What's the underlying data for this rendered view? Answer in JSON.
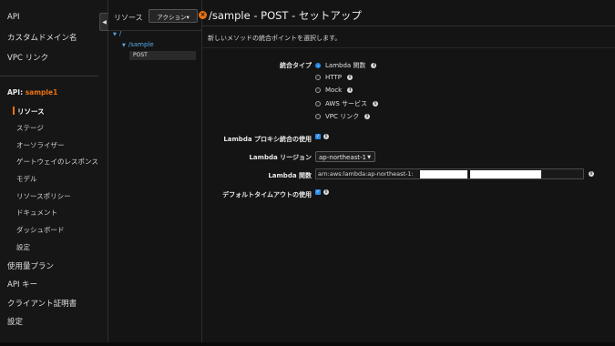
{
  "leftnav": {
    "top_items": [
      "API",
      "カスタムドメイン名",
      "VPC リンク"
    ],
    "api_prefix": "API: ",
    "api_name": "sample1",
    "sub_items": [
      "リソース",
      "ステージ",
      "オーソライザー",
      "ゲートウェイのレスポンス",
      "モデル",
      "リソースポリシー",
      "ドキュメント",
      "ダッシュボード",
      "設定"
    ],
    "bottom_items": [
      "使用量プラン",
      "API キー",
      "クライアント証明書",
      "設定"
    ]
  },
  "tree": {
    "title": "リソース",
    "actions_label": "アクション▾",
    "root": "/",
    "child": "/sample",
    "method": "POST"
  },
  "main": {
    "title": "/sample - POST - セットアップ",
    "subtitle": "新しいメソッドの統合ポイントを選択します。",
    "integration_type_label": "統合タイプ",
    "options": [
      "Lambda 関数",
      "HTTP",
      "Mock",
      "AWS サービス",
      "VPC リンク"
    ],
    "selected_option": "Lambda 関数",
    "proxy_label": "Lambda プロキシ統合の使用",
    "proxy_checked": true,
    "region_label": "Lambda リージョン",
    "region_value": "ap-northeast-1",
    "function_label": "Lambda 関数",
    "function_value": "arn:aws:lambda:ap-northeast-1:",
    "timeout_label": "デフォルトタイムアウトの使用",
    "timeout_checked": true
  },
  "colors": {
    "accent": "#ec7211",
    "link": "#5aa9e6",
    "check": "#2b8be8"
  },
  "icons": {
    "collapse": "chevron-left-icon",
    "close": "close-icon",
    "info": "info-icon"
  }
}
